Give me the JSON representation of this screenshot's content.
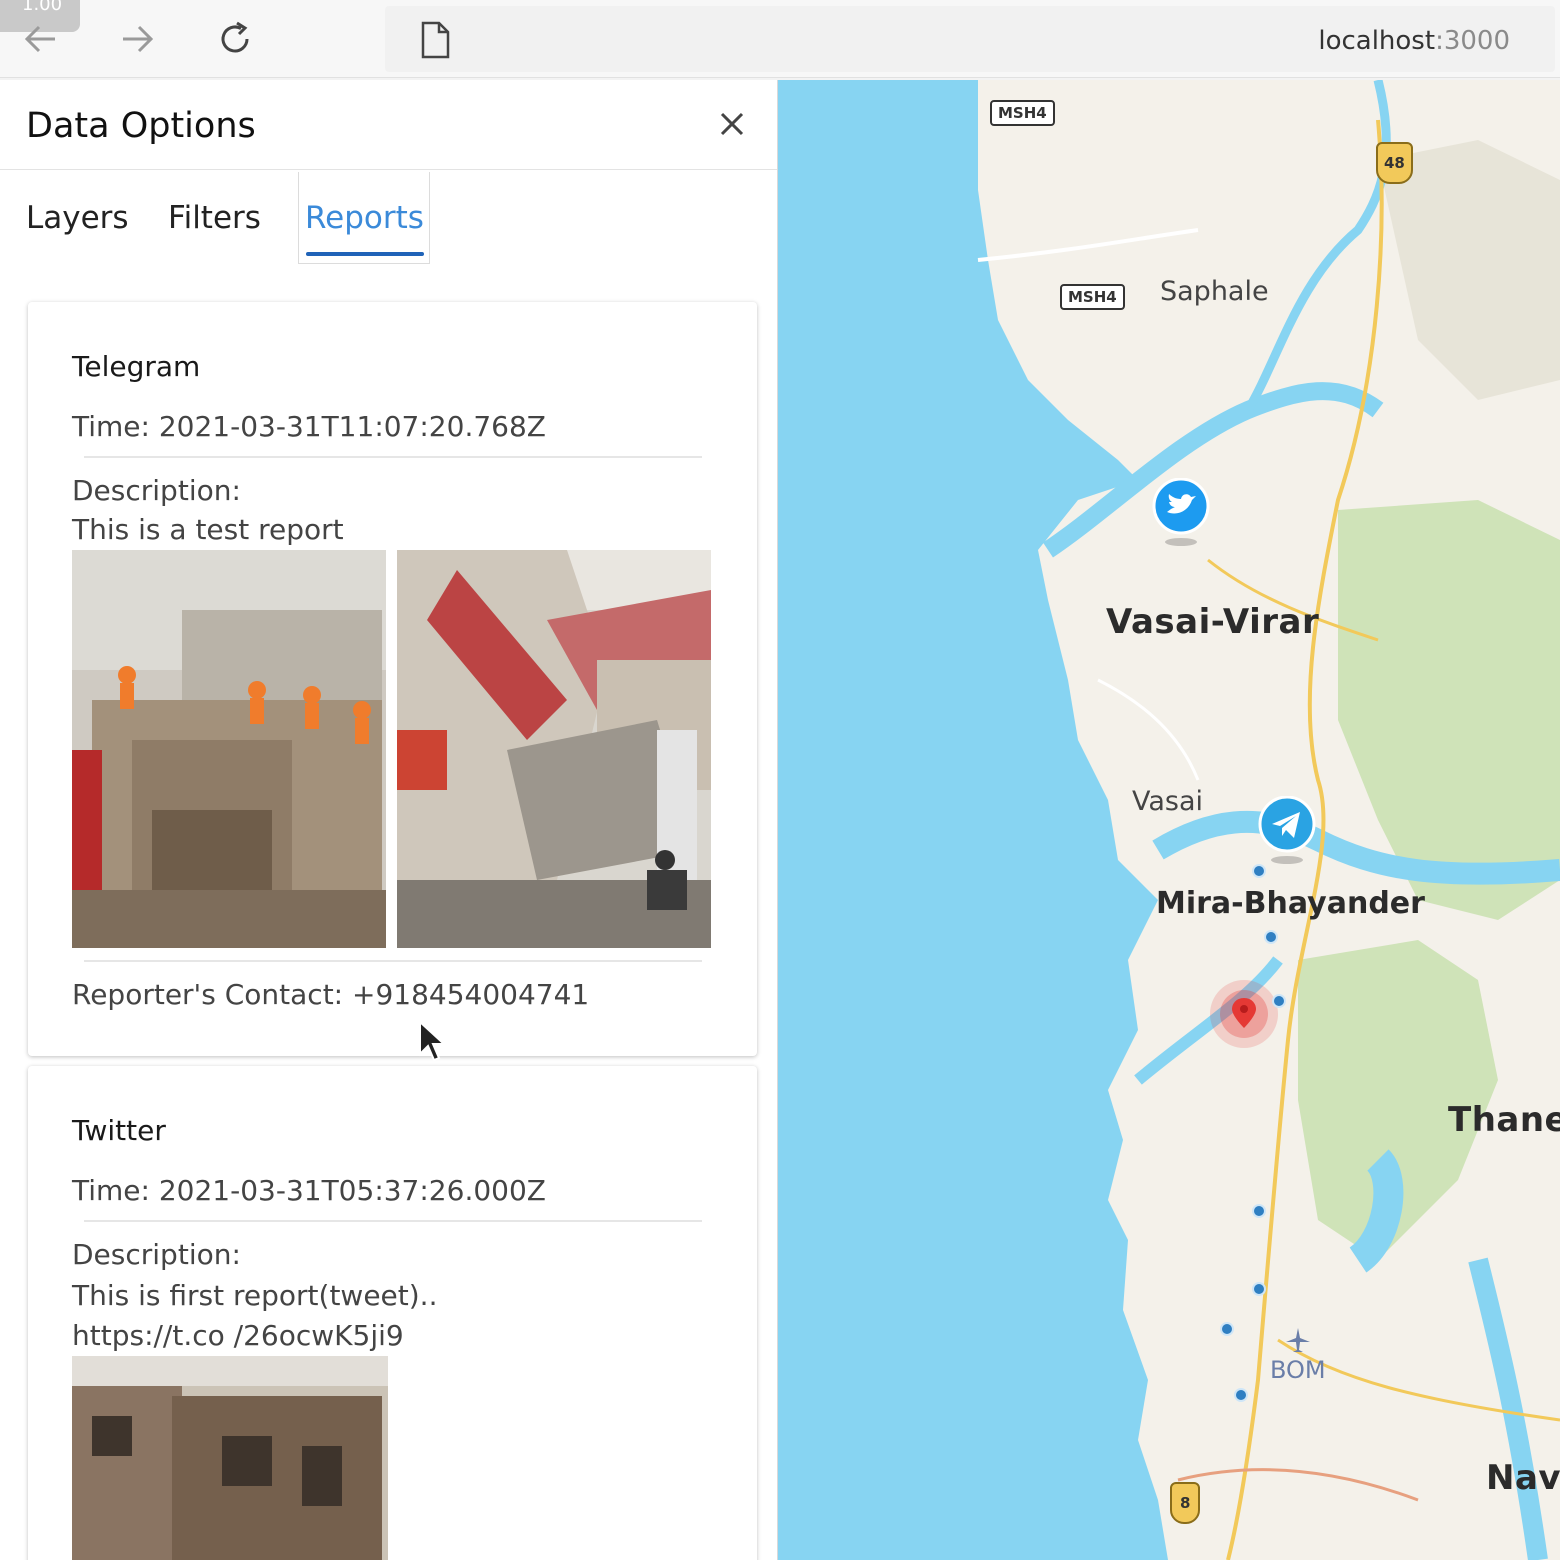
{
  "browser": {
    "corner_badge": "1.00",
    "url_host": "localhost",
    "url_port": ":3000"
  },
  "panel": {
    "title": "Data Options",
    "tabs": [
      {
        "label": "Layers",
        "active": false
      },
      {
        "label": "Filters",
        "active": false
      },
      {
        "label": "Reports",
        "active": true
      }
    ]
  },
  "reports": [
    {
      "source": "Telegram",
      "time": "Time: 2021-03-31T11:07:20.768Z",
      "description_label": "Description:",
      "description": "This is a test report",
      "images": [
        "collapsed-building-rescue-photo",
        "collapsed-building-street-photo"
      ],
      "contact": "Reporter's Contact: +918454004741"
    },
    {
      "source": "Twitter",
      "time": "Time: 2021-03-31T05:37:26.000Z",
      "description_label": "Description:",
      "description": "This is first report(tweet).. https://t.co /26ocwK5ji9",
      "images": [
        "damaged-building-photo"
      ]
    }
  ],
  "map": {
    "labels": {
      "saphale": "Saphale",
      "vasai_virar": "Vasai-Virar",
      "vasai": "Vasai",
      "mira_bhayander": "Mira-Bhayander",
      "thane": "Thane",
      "navi": "Navi",
      "bom": "BOM",
      "msh4_a": "MSH4",
      "msh4_b": "MSH4",
      "nh48": "48",
      "nh8": "8"
    },
    "colors": {
      "water": "#87d4f2",
      "land": "#f4f1ea",
      "park": "#cfe3b8",
      "highway": "#f2c95a",
      "twitter_marker": "#1d9bf0",
      "telegram_marker": "#2aa3e3",
      "alert_marker": "#e53935"
    }
  }
}
